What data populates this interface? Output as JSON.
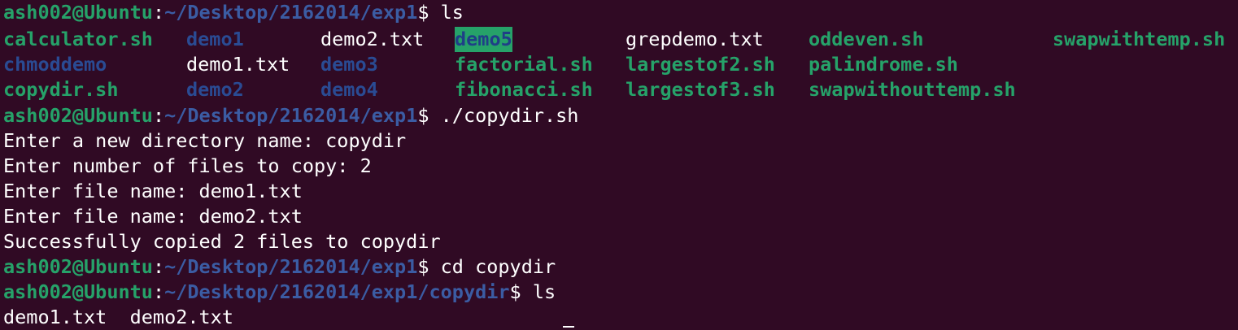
{
  "prompt": {
    "user_host": "ash002@Ubuntu",
    "colon": ":",
    "base_path": "~/Desktop/2162014/exp1",
    "sub_path": "~/Desktop/2162014/exp1/copydir",
    "dollar": "$"
  },
  "commands": {
    "cmd1": " ls",
    "cmd2": " ./copydir.sh",
    "cmd3": " cd copydir",
    "cmd4": " ls"
  },
  "ls_listing": [
    [
      "calculator.sh",
      "demo1",
      "demo2.txt",
      "demo5",
      "grepdemo.txt",
      "oddeven.sh",
      "swapwithtemp.sh"
    ],
    [
      "chmoddemo",
      "demo1.txt",
      "demo3",
      "factorial.sh",
      "largestof2.sh",
      "palindrome.sh"
    ],
    [
      "copydir.sh",
      "demo2",
      "demo4",
      "fibonacci.sh",
      "largestof3.sh",
      "swapwithouttemp.sh"
    ]
  ],
  "script_output": [
    "Enter a new directory name: copydir",
    "Enter number of files to copy: 2",
    "Enter file name: demo1.txt",
    "Enter file name: demo2.txt",
    "Successfully copied 2 files to copydir"
  ],
  "final_listing": "demo1.txt  demo2.txt",
  "colors": {
    "background": "#300a24",
    "prompt_user": "#26a269",
    "prompt_path": "#3b5ca3",
    "executable": "#26a269",
    "directory": "#2a4b93",
    "highlight_bg": "#26a269",
    "text": "#ffffff"
  }
}
